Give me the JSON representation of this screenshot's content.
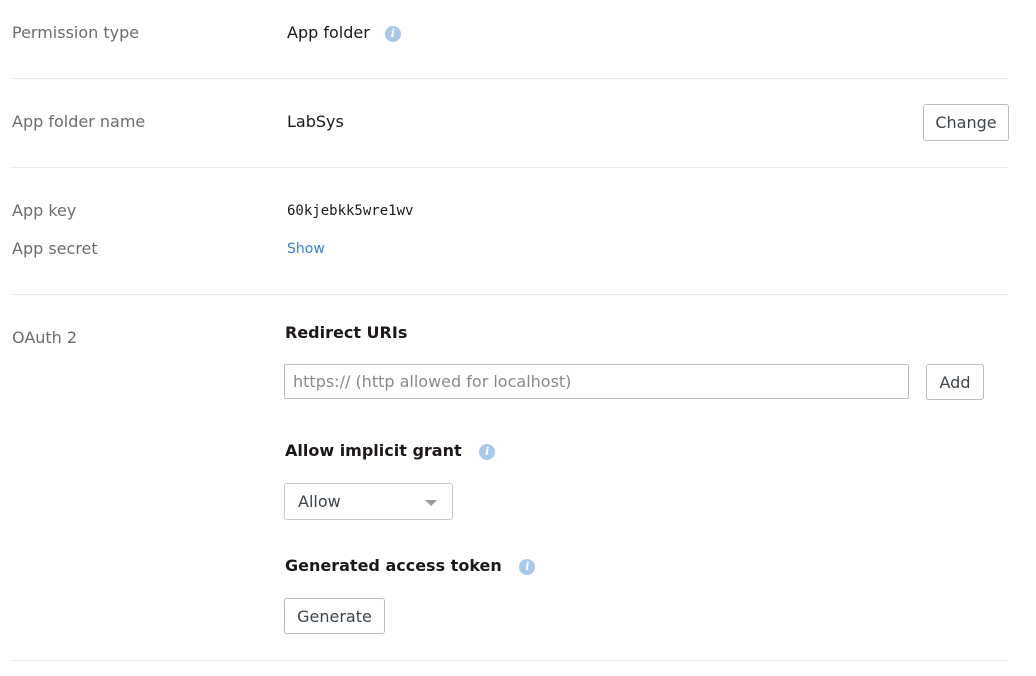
{
  "permission": {
    "label": "Permission type",
    "value": "App folder",
    "info_icon": "info-icon"
  },
  "app_folder": {
    "label": "App folder name",
    "value": "LabSys",
    "change_label": "Change"
  },
  "keys": {
    "app_key_label": "App key",
    "app_key_value": "60kjebkk5wre1wv",
    "app_secret_label": "App secret",
    "show_label": "Show"
  },
  "oauth": {
    "label": "OAuth 2",
    "redirect_heading": "Redirect URIs",
    "redirect_placeholder": "https:// (http allowed for localhost)",
    "redirect_value": "",
    "add_label": "Add",
    "implicit_heading": "Allow implicit grant",
    "implicit_selected": "Allow",
    "token_heading": "Generated access token",
    "generate_label": "Generate"
  },
  "colors": {
    "label_gray": "#6d6d6d",
    "link_blue": "#3a81d4",
    "info_icon": "#a9c8ec",
    "divider": "#ececec"
  }
}
